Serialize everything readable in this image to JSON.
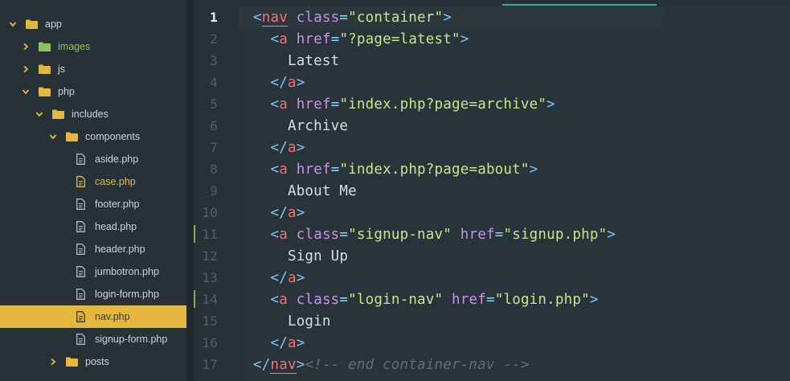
{
  "sidebar": {
    "items": [
      {
        "name": "app",
        "kind": "folder",
        "open": true,
        "depth": 0
      },
      {
        "name": "images",
        "kind": "folder",
        "open": false,
        "depth": 1,
        "status": "added"
      },
      {
        "name": "js",
        "kind": "folder",
        "open": false,
        "depth": 1
      },
      {
        "name": "php",
        "kind": "folder",
        "open": true,
        "depth": 1
      },
      {
        "name": "includes",
        "kind": "folder",
        "open": true,
        "depth": 2
      },
      {
        "name": "components",
        "kind": "folder",
        "open": true,
        "depth": 3
      },
      {
        "name": "aside.php",
        "kind": "file",
        "depth": 4
      },
      {
        "name": "case.php",
        "kind": "file",
        "depth": 4,
        "status": "modified"
      },
      {
        "name": "footer.php",
        "kind": "file",
        "depth": 4
      },
      {
        "name": "head.php",
        "kind": "file",
        "depth": 4
      },
      {
        "name": "header.php",
        "kind": "file",
        "depth": 4
      },
      {
        "name": "jumbotron.php",
        "kind": "file",
        "depth": 4
      },
      {
        "name": "login-form.php",
        "kind": "file",
        "depth": 4
      },
      {
        "name": "nav.php",
        "kind": "file",
        "depth": 4,
        "selected": true
      },
      {
        "name": "signup-form.php",
        "kind": "file",
        "depth": 4
      },
      {
        "name": "posts",
        "kind": "folder",
        "open": false,
        "depth": 3
      }
    ]
  },
  "editor": {
    "current_line": 1,
    "modified_lines": [
      11,
      14
    ],
    "lines": [
      {
        "n": "1",
        "indent": "",
        "tokens": [
          [
            "brk",
            "<"
          ],
          [
            "tag",
            "nav"
          ],
          [
            "txt",
            " "
          ],
          [
            "attr",
            "class"
          ],
          [
            "eq",
            "="
          ],
          [
            "str",
            "\"container\""
          ],
          [
            "brk",
            ">"
          ]
        ]
      },
      {
        "n": "2",
        "indent": "  ",
        "tokens": [
          [
            "brk",
            "<"
          ],
          [
            "tag",
            "a"
          ],
          [
            "txt",
            " "
          ],
          [
            "attr",
            "href"
          ],
          [
            "eq",
            "="
          ],
          [
            "str",
            "\"?page=latest\""
          ],
          [
            "brk",
            ">"
          ]
        ]
      },
      {
        "n": "3",
        "indent": "    ",
        "tokens": [
          [
            "txt",
            "Latest"
          ]
        ]
      },
      {
        "n": "4",
        "indent": "  ",
        "tokens": [
          [
            "brk",
            "</"
          ],
          [
            "tag",
            "a"
          ],
          [
            "brk",
            ">"
          ]
        ]
      },
      {
        "n": "5",
        "indent": "  ",
        "tokens": [
          [
            "brk",
            "<"
          ],
          [
            "tag",
            "a"
          ],
          [
            "txt",
            " "
          ],
          [
            "attr",
            "href"
          ],
          [
            "eq",
            "="
          ],
          [
            "str",
            "\"index.php?page=archive\""
          ],
          [
            "brk",
            ">"
          ]
        ]
      },
      {
        "n": "6",
        "indent": "    ",
        "tokens": [
          [
            "txt",
            "Archive"
          ]
        ]
      },
      {
        "n": "7",
        "indent": "  ",
        "tokens": [
          [
            "brk",
            "</"
          ],
          [
            "tag",
            "a"
          ],
          [
            "brk",
            ">"
          ]
        ]
      },
      {
        "n": "8",
        "indent": "  ",
        "tokens": [
          [
            "brk",
            "<"
          ],
          [
            "tag",
            "a"
          ],
          [
            "txt",
            " "
          ],
          [
            "attr",
            "href"
          ],
          [
            "eq",
            "="
          ],
          [
            "str",
            "\"index.php?page=about\""
          ],
          [
            "brk",
            ">"
          ]
        ]
      },
      {
        "n": "9",
        "indent": "    ",
        "tokens": [
          [
            "txt",
            "About Me"
          ]
        ]
      },
      {
        "n": "10",
        "indent": "  ",
        "tokens": [
          [
            "brk",
            "</"
          ],
          [
            "tag",
            "a"
          ],
          [
            "brk",
            ">"
          ]
        ]
      },
      {
        "n": "11",
        "indent": "  ",
        "tokens": [
          [
            "brk",
            "<"
          ],
          [
            "tag",
            "a"
          ],
          [
            "txt",
            " "
          ],
          [
            "attr",
            "class"
          ],
          [
            "eq",
            "="
          ],
          [
            "str",
            "\"signup-nav\""
          ],
          [
            "txt",
            " "
          ],
          [
            "attr",
            "href"
          ],
          [
            "eq",
            "="
          ],
          [
            "str",
            "\"signup.php\""
          ],
          [
            "brk",
            ">"
          ]
        ]
      },
      {
        "n": "12",
        "indent": "    ",
        "tokens": [
          [
            "txt",
            "Sign Up"
          ]
        ]
      },
      {
        "n": "13",
        "indent": "  ",
        "tokens": [
          [
            "brk",
            "</"
          ],
          [
            "tag",
            "a"
          ],
          [
            "brk",
            ">"
          ]
        ]
      },
      {
        "n": "14",
        "indent": "  ",
        "tokens": [
          [
            "brk",
            "<"
          ],
          [
            "tag",
            "a"
          ],
          [
            "txt",
            " "
          ],
          [
            "attr",
            "class"
          ],
          [
            "eq",
            "="
          ],
          [
            "str",
            "\"login-nav\""
          ],
          [
            "txt",
            " "
          ],
          [
            "attr",
            "href"
          ],
          [
            "eq",
            "="
          ],
          [
            "str",
            "\"login.php\""
          ],
          [
            "brk",
            ">"
          ]
        ]
      },
      {
        "n": "15",
        "indent": "    ",
        "tokens": [
          [
            "txt",
            "Login"
          ]
        ]
      },
      {
        "n": "16",
        "indent": "  ",
        "tokens": [
          [
            "brk",
            "</"
          ],
          [
            "tag",
            "a"
          ],
          [
            "brk",
            ">"
          ]
        ]
      },
      {
        "n": "17",
        "indent": "",
        "tokens": [
          [
            "brk",
            "</"
          ],
          [
            "tag",
            "nav"
          ],
          [
            "brk",
            ">"
          ],
          [
            "cmt",
            "<!-- end container-nav -->"
          ]
        ]
      }
    ]
  },
  "colors": {
    "background": "#263238",
    "selection": "#e6b73e",
    "tag": "#f07178",
    "attribute": "#c792ea",
    "string": "#c3e88d",
    "bracket": "#82c0f2",
    "comment": "#5c707a"
  }
}
